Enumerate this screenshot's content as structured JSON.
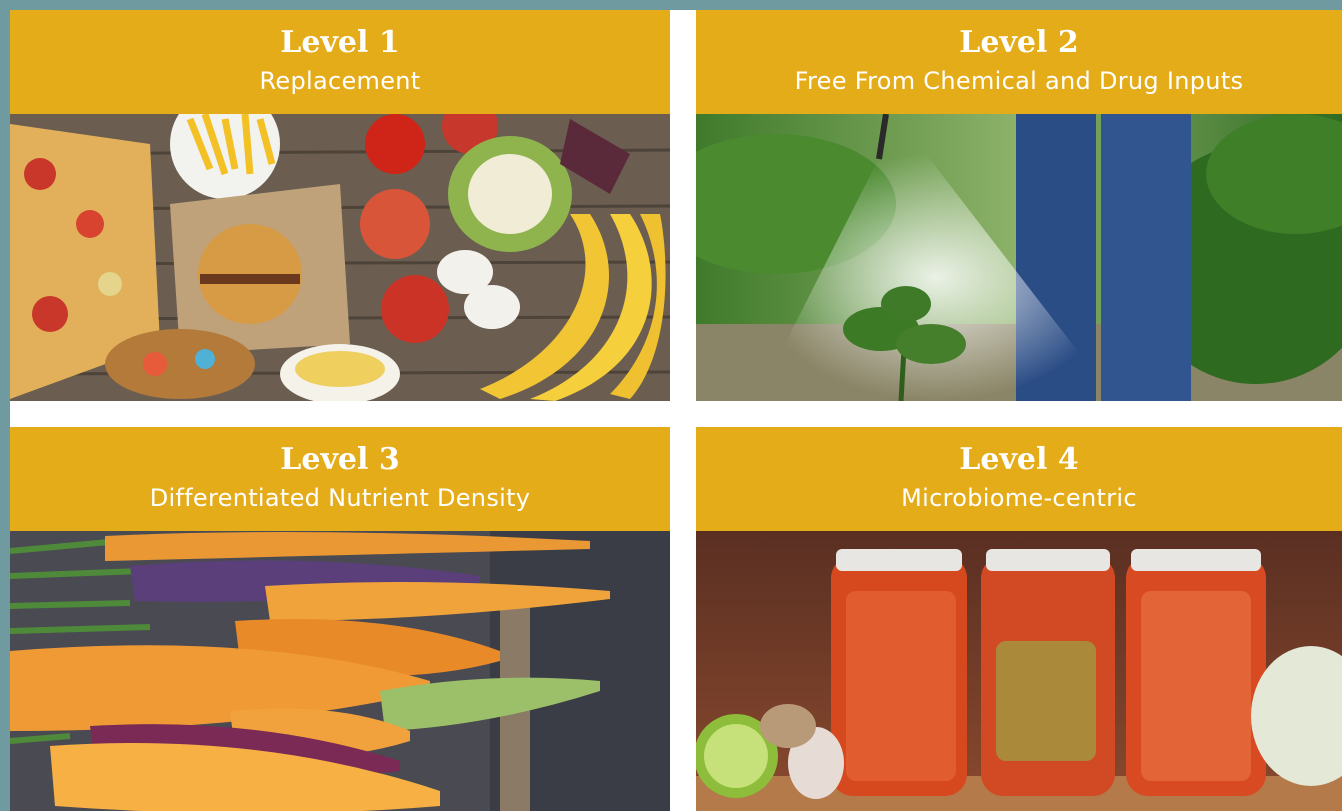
{
  "colors": {
    "frame": "#6f9ba0",
    "header": "#e5ac1a",
    "header_text": "#ffffff",
    "background": "#ffffff"
  },
  "cards": [
    {
      "title": "Level 1",
      "subtitle": "Replacement",
      "image": "junk-food-vs-fruit-photo"
    },
    {
      "title": "Level 2",
      "subtitle": "Free From Chemical and Drug Inputs",
      "image": "crop-spraying-photo"
    },
    {
      "title": "Level 3",
      "subtitle": "Differentiated Nutrient Density",
      "image": "heirloom-carrots-photo"
    },
    {
      "title": "Level 4",
      "subtitle": "Microbiome-centric",
      "image": "kimchi-jars-photo"
    }
  ]
}
